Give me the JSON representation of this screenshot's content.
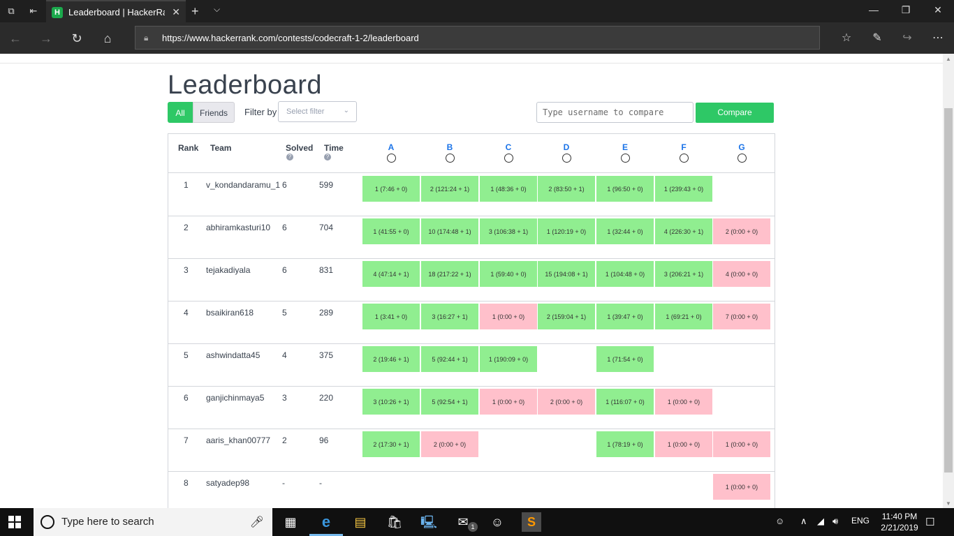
{
  "browser": {
    "tab_title": "Leaderboard | HackerRank",
    "tab_favicon": "H",
    "url": "https://www.hackerrank.com/contests/codecraft-1-2/leaderboard"
  },
  "page": {
    "title": "Leaderboard",
    "filter_all": "All",
    "filter_friends": "Friends",
    "filter_by_label": "Filter by",
    "select_filter_placeholder": "Select filter",
    "compare_placeholder": "Type username to compare",
    "compare_button": "Compare"
  },
  "table": {
    "headers": {
      "rank": "Rank",
      "team": "Team",
      "solved": "Solved",
      "time": "Time"
    },
    "help_glyph": "?",
    "challenges": [
      "A",
      "B",
      "C",
      "D",
      "E",
      "F",
      "G"
    ],
    "rows": [
      {
        "rank": "1",
        "team": "v_kondandaramu_1",
        "solved": "6",
        "time": "599",
        "scores": [
          {
            "text": "1 (7:46 + 0)",
            "status": "ok"
          },
          {
            "text": "2 (121:24 + 1)",
            "status": "ok"
          },
          {
            "text": "1 (48:36 + 0)",
            "status": "ok"
          },
          {
            "text": "2 (83:50 + 1)",
            "status": "ok"
          },
          {
            "text": "1 (96:50 + 0)",
            "status": "ok"
          },
          {
            "text": "1 (239:43 + 0)",
            "status": "ok"
          },
          null
        ]
      },
      {
        "rank": "2",
        "team": "abhiramkasturi10",
        "solved": "6",
        "time": "704",
        "scores": [
          {
            "text": "1 (41:55 + 0)",
            "status": "ok"
          },
          {
            "text": "10 (174:48 + 1)",
            "status": "ok"
          },
          {
            "text": "3 (106:38 + 1)",
            "status": "ok"
          },
          {
            "text": "1 (120:19 + 0)",
            "status": "ok"
          },
          {
            "text": "1 (32:44 + 0)",
            "status": "ok"
          },
          {
            "text": "4 (226:30 + 1)",
            "status": "ok"
          },
          {
            "text": "2 (0:00 + 0)",
            "status": "bad"
          }
        ]
      },
      {
        "rank": "3",
        "team": "tejakadiyala",
        "solved": "6",
        "time": "831",
        "scores": [
          {
            "text": "4 (47:14 + 1)",
            "status": "ok"
          },
          {
            "text": "18 (217:22 + 1)",
            "status": "ok"
          },
          {
            "text": "1 (59:40 + 0)",
            "status": "ok"
          },
          {
            "text": "15 (194:08 + 1)",
            "status": "ok"
          },
          {
            "text": "1 (104:48 + 0)",
            "status": "ok"
          },
          {
            "text": "3 (206:21 + 1)",
            "status": "ok"
          },
          {
            "text": "4 (0:00 + 0)",
            "status": "bad"
          }
        ]
      },
      {
        "rank": "4",
        "team": "bsaikiran618",
        "solved": "5",
        "time": "289",
        "scores": [
          {
            "text": "1 (3:41 + 0)",
            "status": "ok"
          },
          {
            "text": "3 (16:27 + 1)",
            "status": "ok"
          },
          {
            "text": "1 (0:00 + 0)",
            "status": "bad"
          },
          {
            "text": "2 (159:04 + 1)",
            "status": "ok"
          },
          {
            "text": "1 (39:47 + 0)",
            "status": "ok"
          },
          {
            "text": "1 (69:21 + 0)",
            "status": "ok"
          },
          {
            "text": "7 (0:00 + 0)",
            "status": "bad"
          }
        ]
      },
      {
        "rank": "5",
        "team": "ashwindatta45",
        "solved": "4",
        "time": "375",
        "scores": [
          {
            "text": "2 (19:46 + 1)",
            "status": "ok"
          },
          {
            "text": "5 (92:44 + 1)",
            "status": "ok"
          },
          {
            "text": "1 (190:09 + 0)",
            "status": "ok"
          },
          null,
          {
            "text": "1 (71:54 + 0)",
            "status": "ok"
          },
          null,
          null
        ]
      },
      {
        "rank": "6",
        "team": "ganjichinmaya5",
        "solved": "3",
        "time": "220",
        "scores": [
          {
            "text": "3 (10:26 + 1)",
            "status": "ok"
          },
          {
            "text": "5 (92:54 + 1)",
            "status": "ok"
          },
          {
            "text": "1 (0:00 + 0)",
            "status": "bad"
          },
          {
            "text": "2 (0:00 + 0)",
            "status": "bad"
          },
          {
            "text": "1 (116:07 + 0)",
            "status": "ok"
          },
          {
            "text": "1 (0:00 + 0)",
            "status": "bad"
          },
          null
        ]
      },
      {
        "rank": "7",
        "team": "aaris_khan00777",
        "solved": "2",
        "time": "96",
        "scores": [
          {
            "text": "2 (17:30 + 1)",
            "status": "ok"
          },
          {
            "text": "2 (0:00 + 0)",
            "status": "bad"
          },
          null,
          null,
          {
            "text": "1 (78:19 + 0)",
            "status": "ok"
          },
          {
            "text": "1 (0:00 + 0)",
            "status": "bad"
          },
          {
            "text": "1 (0:00 + 0)",
            "status": "bad"
          }
        ]
      },
      {
        "rank": "8",
        "team": "satyadep98",
        "solved": "-",
        "time": "-",
        "scores": [
          null,
          null,
          null,
          null,
          null,
          null,
          {
            "text": "1 (0:00 + 0)",
            "status": "bad"
          }
        ]
      }
    ]
  },
  "taskbar": {
    "search_placeholder": "Type here to search",
    "language": "ENG",
    "time": "11:40 PM",
    "date": "2/21/2019",
    "mail_badge": "1"
  },
  "colors": {
    "accent_green": "#2ec866",
    "solved_cell": "#90ee90",
    "failed_cell": "#ffc0cb",
    "challenge_link": "#1a73e8"
  }
}
